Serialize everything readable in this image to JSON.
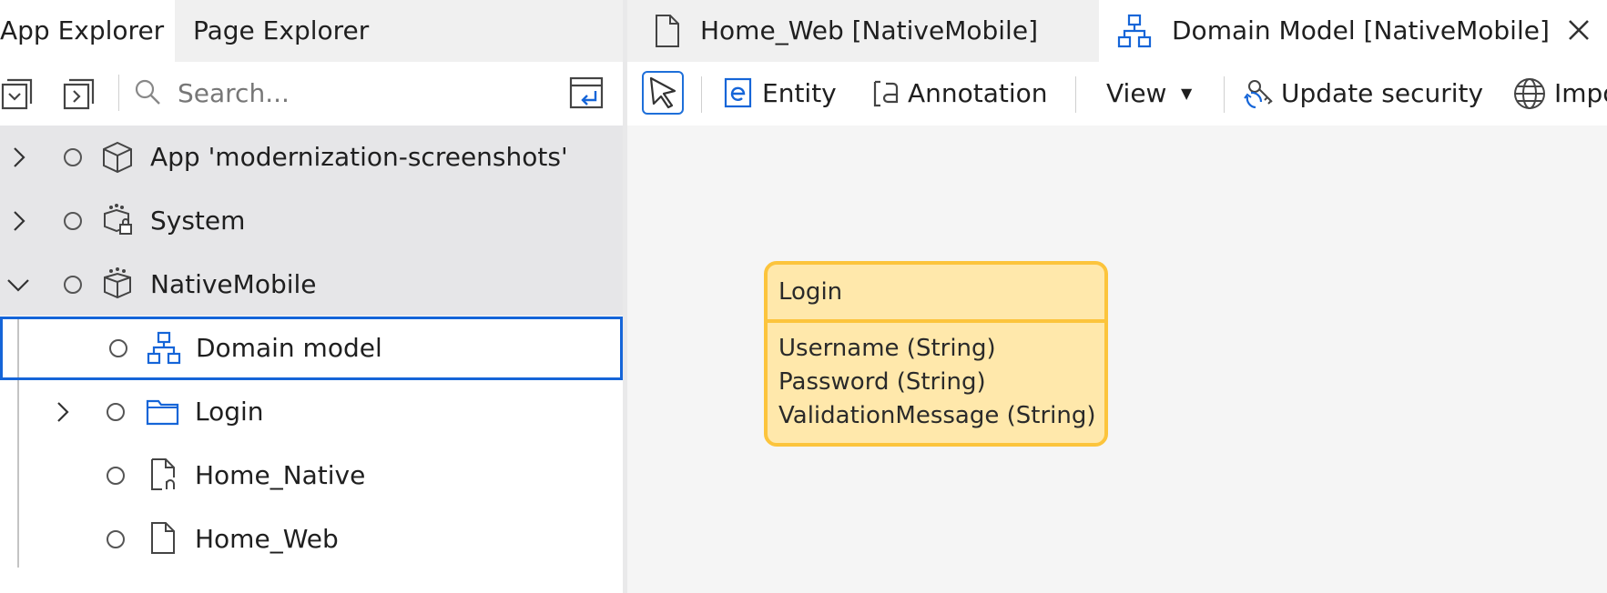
{
  "explorer": {
    "tabs": [
      {
        "label": "App Explorer",
        "active": true
      },
      {
        "label": "Page Explorer",
        "active": false
      }
    ],
    "search": {
      "placeholder": "Search..."
    },
    "tree": [
      {
        "label": "App 'modernization-screenshots'",
        "icon": "cube-icon",
        "expanded": false
      },
      {
        "label": "System",
        "icon": "system-module-icon",
        "expanded": false
      },
      {
        "label": "NativeMobile",
        "icon": "module-icon",
        "expanded": true
      },
      {
        "label": "Domain model",
        "icon": "domain-model-icon",
        "selected": true
      },
      {
        "label": "Login",
        "icon": "folder-icon",
        "expanded": false
      },
      {
        "label": "Home_Native",
        "icon": "native-page-icon"
      },
      {
        "label": "Home_Web",
        "icon": "page-icon"
      }
    ]
  },
  "editor": {
    "tabs": [
      {
        "label": "Home_Web [NativeMobile]",
        "icon": "page-icon",
        "active": false
      },
      {
        "label": "Domain Model [NativeMobile]",
        "icon": "domain-model-icon",
        "active": true
      }
    ],
    "toolbar": {
      "entity": "Entity",
      "annotation": "Annotation",
      "view": "View",
      "update_security": "Update security",
      "import": "Impo"
    },
    "entity": {
      "name": "Login",
      "attributes": [
        "Username (String)",
        "Password (String)",
        "ValidationMessage (String)"
      ]
    }
  },
  "colors": {
    "accent_blue": "#1565d8",
    "entity_fill": "#ffe8ab",
    "entity_border": "#fcc43c",
    "canvas_bg": "#f5f5f5",
    "tree_highlight_bg": "#e6e6e8"
  }
}
